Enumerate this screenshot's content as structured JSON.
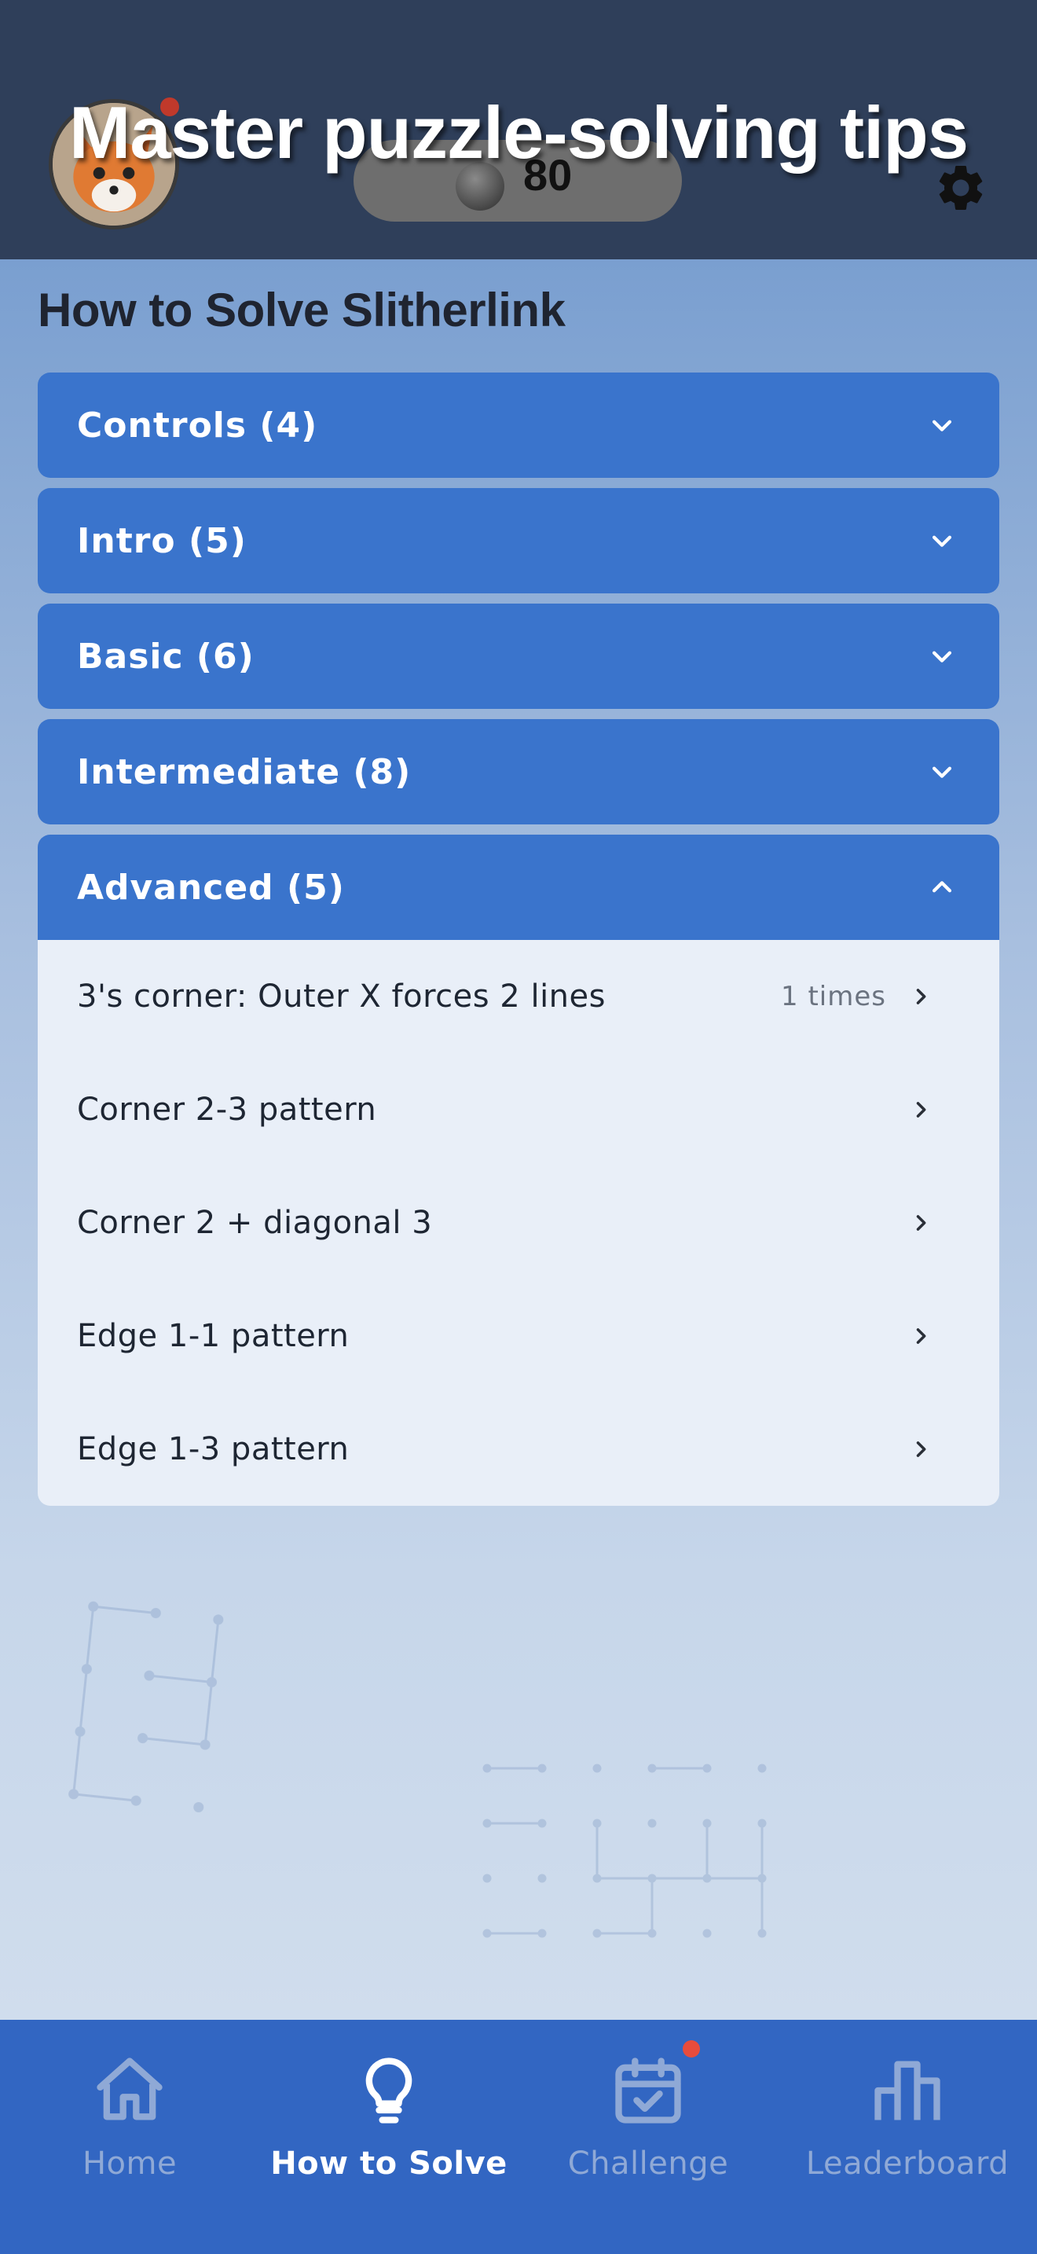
{
  "header": {
    "title": "Master puzzle-solving tips",
    "coins": "80",
    "avatar_icon": "fox-avatar",
    "settings_icon": "gear-icon"
  },
  "page": {
    "title": "How to Solve Slitherlink"
  },
  "sections": [
    {
      "label": "Controls (4)",
      "expanded": false
    },
    {
      "label": "Intro (5)",
      "expanded": false
    },
    {
      "label": "Basic (6)",
      "expanded": false
    },
    {
      "label": "Intermediate (8)",
      "expanded": false
    },
    {
      "label": "Advanced (5)",
      "expanded": true
    }
  ],
  "advanced_items": [
    {
      "label": "3's corner: Outer X forces 2 lines",
      "count": "1 times"
    },
    {
      "label": "Corner 2-3 pattern",
      "count": ""
    },
    {
      "label": "Corner 2 + diagonal 3",
      "count": ""
    },
    {
      "label": "Edge 1-1 pattern",
      "count": ""
    },
    {
      "label": "Edge 1-3 pattern",
      "count": ""
    }
  ],
  "nav": [
    {
      "label": "Home",
      "icon": "home-icon",
      "active": false
    },
    {
      "label": "How to Solve",
      "icon": "lightbulb-icon",
      "active": true
    },
    {
      "label": "Challenge",
      "icon": "calendar-check-icon",
      "active": false
    },
    {
      "label": "Leaderboard",
      "icon": "bar-chart-icon",
      "active": false
    }
  ],
  "colors": {
    "header_bg": "#2f3f5a",
    "accordion_blue": "#3a74cc",
    "nav_bg": "#3266c2",
    "notification": "#e74c3c"
  }
}
